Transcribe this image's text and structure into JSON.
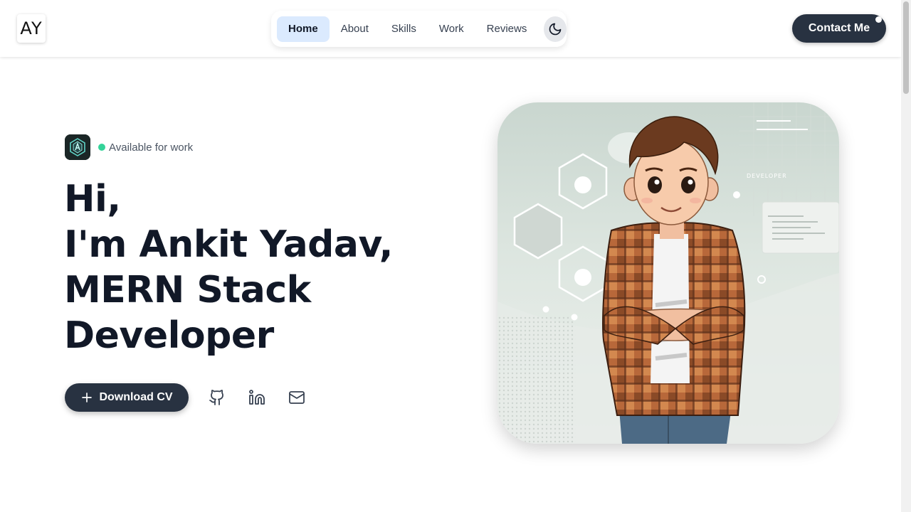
{
  "header": {
    "logo_text": "AY",
    "nav": [
      {
        "label": "Home",
        "active": true
      },
      {
        "label": "About",
        "active": false
      },
      {
        "label": "Skills",
        "active": false
      },
      {
        "label": "Work",
        "active": false
      },
      {
        "label": "Reviews",
        "active": false
      }
    ],
    "theme_toggle_icon": "moon-icon",
    "contact_label": "Contact Me"
  },
  "hero": {
    "status_text": "Available for work",
    "status_color": "#34d399",
    "greeting": "Hi,",
    "name_line": "I'm Ankit Yadav,",
    "role_line1": "MERN Stack",
    "role_line2": "Developer",
    "download_label": "Download CV",
    "social_icons": [
      "github-icon",
      "linkedin-icon",
      "mail-icon"
    ]
  },
  "portrait": {
    "screen_label": "DEVELOPER"
  },
  "colors": {
    "dark_button": "#283241",
    "active_nav": "#dbeafe"
  }
}
